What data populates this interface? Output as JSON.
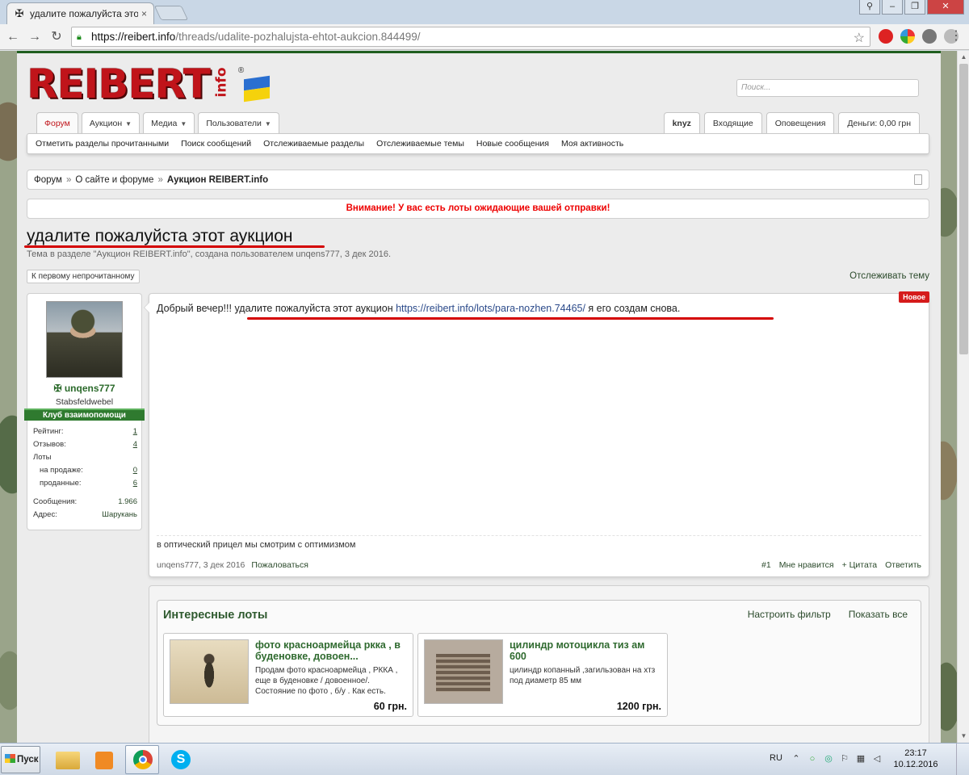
{
  "browser": {
    "tab_title": "удалите пожалуйста этот",
    "tab_close": "×",
    "url_host": "https://reibert.info",
    "url_path": "/threads/udalite-pozhalujsta-ehtot-aukcion.844499/"
  },
  "site": {
    "logo_text": "REIBERT",
    "logo_info": "info",
    "logo_reg": "®",
    "search_placeholder": "Поиск...",
    "flag_colors": [
      "#2a6fd0",
      "#f5d20c"
    ],
    "accent_color": "#c0141a",
    "brand_green": "#2f6a2f"
  },
  "nav": {
    "tabs": [
      {
        "label": "Форум",
        "active": true
      },
      {
        "label": "Аукцион",
        "dropdown": true
      },
      {
        "label": "Медиа",
        "dropdown": true
      },
      {
        "label": "Пользователи",
        "dropdown": true
      }
    ],
    "user_tabs": [
      {
        "label": "knyz"
      },
      {
        "label": "Входящие"
      },
      {
        "label": "Оповещения"
      },
      {
        "label": "Деньги: 0,00 грн"
      }
    ],
    "sublinks": [
      "Отметить разделы прочитанными",
      "Поиск сообщений",
      "Отслеживаемые разделы",
      "Отслеживаемые темы",
      "Новые сообщения",
      "Моя активность"
    ]
  },
  "breadcrumb": {
    "items": [
      "Форум",
      "О сайте и форуме",
      "Аукцион REIBERT.info"
    ],
    "separator": "»"
  },
  "notice": "Внимание! У вас есть лоты ожидающие вашей отправки!",
  "thread": {
    "title": "удалите пожалуйста этот аукцион",
    "meta": "Тема в разделе \"Аукцион REIBERT.info\", создана пользователем unqens777, 3 дек 2016.",
    "first_unread": "К первому непрочитанному",
    "follow": "Отслеживать тему"
  },
  "post": {
    "author": {
      "name": "unqens777",
      "icon": "iron-cross",
      "rank": "Stabsfeldwebel",
      "group": "Клуб взаимопомощи",
      "stats": [
        {
          "label": "Рейтинг:",
          "value": "1",
          "link": true
        },
        {
          "label": "Отзывов:",
          "value": "4",
          "link": true
        },
        {
          "label": "Лоты",
          "value": ""
        },
        {
          "label": "на продаже:",
          "value": "0",
          "link": true,
          "indent": true
        },
        {
          "label": "проданные:",
          "value": "6",
          "link": true,
          "indent": true
        },
        {
          "label": "Сообщения:",
          "value": "1.966"
        },
        {
          "label": "Адрес:",
          "value": "Шарукань"
        }
      ]
    },
    "badge": "Новое",
    "text_start": "Добрый вечер!!! ",
    "text_phrase": "удалите пожалуйста этот аукцион ",
    "text_link": "https://reibert.info/lots/para-nozhen.74465/",
    "text_end": " я его создам снова.",
    "signature": "в оптический прицел мы смотрим с оптимизмом",
    "footer": {
      "author_date": "unqens777, 3 дек 2016",
      "report": "Пожаловаться",
      "number": "#1",
      "like": "Мне нравится",
      "quote": "+ Цитата",
      "reply": "Ответить"
    }
  },
  "lots": {
    "title": "Интересные лоты",
    "filter": "Настроить фильтр",
    "show_all": "Показать все",
    "items": [
      {
        "name": "фото красноармейца ркка , в буденовке, довоен...",
        "desc": "Продам фото красноармейца , РККА , еще в буденовке / довоенное/. Состояние по фото , б/у . Как есть.",
        "price": "60 грн."
      },
      {
        "name": "цилиндр мотоцикла тиз ам 600",
        "desc": "цилиндр копанный ,загильзован на хтз под диаметр 85 мм",
        "price": "1200 грн."
      }
    ]
  },
  "taskbar": {
    "start": "Пуск",
    "lang": "RU",
    "time": "23:17",
    "date": "10.12.2016"
  }
}
